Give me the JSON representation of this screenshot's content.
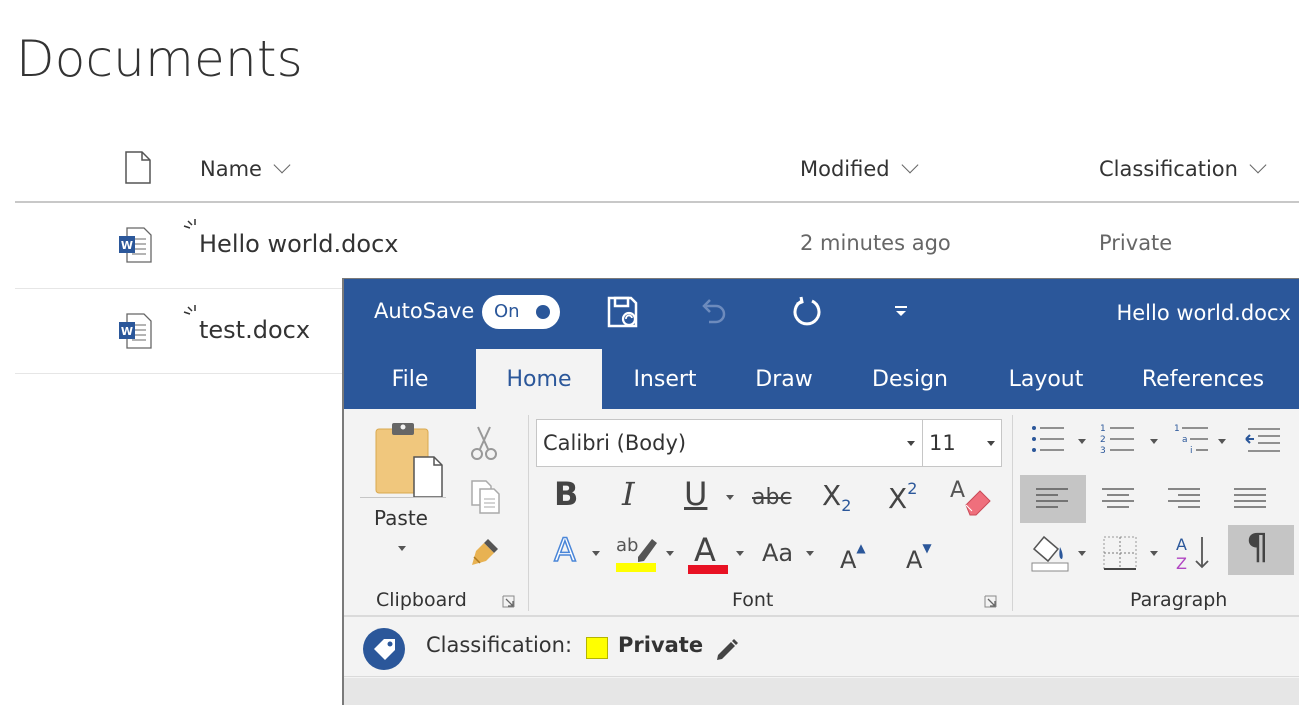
{
  "library": {
    "title": "Documents",
    "columns": {
      "name": "Name",
      "modified": "Modified",
      "classification": "Classification"
    },
    "rows": [
      {
        "name": "Hello world.docx",
        "modified": "2 minutes ago",
        "classification": "Private"
      },
      {
        "name": "test.docx",
        "modified": "",
        "classification": ""
      }
    ]
  },
  "word": {
    "autosave_label": "AutoSave",
    "autosave_state": "On",
    "document_title": "Hello world.docx",
    "tabs": [
      "File",
      "Home",
      "Insert",
      "Draw",
      "Design",
      "Layout",
      "References"
    ],
    "active_tab": "Home",
    "ribbon": {
      "paste_label": "Paste",
      "clipboard_label": "Clipboard",
      "font_label": "Font",
      "paragraph_label": "Paragraph",
      "font_name": "Calibri (Body)",
      "font_size": "11",
      "change_case_label": "Aa"
    },
    "classification": {
      "label": "Classification:",
      "value": "Private",
      "swatch_color": "#ffff00"
    }
  },
  "colors": {
    "word_blue": "#2b579a",
    "ribbon_bg": "#f3f3f3",
    "highlight_yellow": "#ffff00",
    "font_red": "#e81123"
  }
}
